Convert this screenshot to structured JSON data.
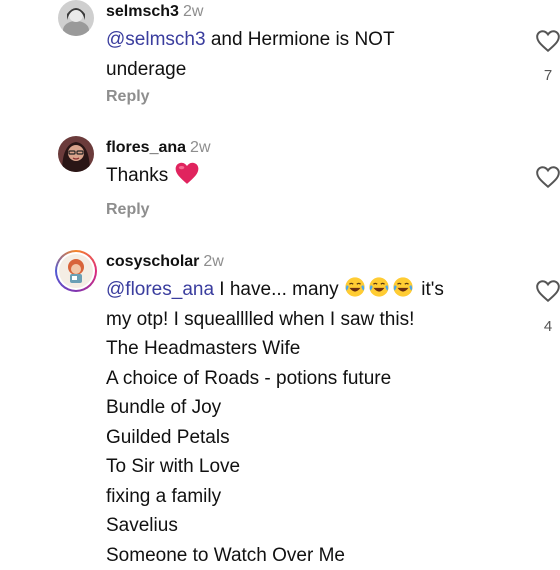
{
  "colors": {
    "mention": "#3a3d9e",
    "muted": "#8e8e8e",
    "heart_red": "#e0245e"
  },
  "comments": [
    {
      "username": "selmsch3",
      "time": "2w",
      "mention": "@selmsch3",
      "text_line1": " and Hermione is NOT",
      "text_line2": "underage",
      "reply_label": "Reply",
      "like_count": "7"
    },
    {
      "username": "flores_ana",
      "time": "2w",
      "text": "Thanks",
      "emoji": "red-heart",
      "reply_label": "Reply",
      "like_count": ""
    },
    {
      "username": "cosyscholar",
      "time": "2w",
      "mention": "@flores_ana",
      "text_a": " I have... many ",
      "emoji": "face-with-tears-of-joy",
      "emoji_count": 3,
      "text_b": " it's",
      "text_line2": "my otp! I squealllled when I saw this!",
      "titles": [
        "The Headmasters Wife",
        "A choice of Roads - potions future",
        "Bundle of Joy",
        "Guilded Petals",
        "To Sir with Love",
        "fixing a family",
        "Savelius",
        "Someone to Watch Over Me"
      ],
      "like_count": "4"
    }
  ]
}
